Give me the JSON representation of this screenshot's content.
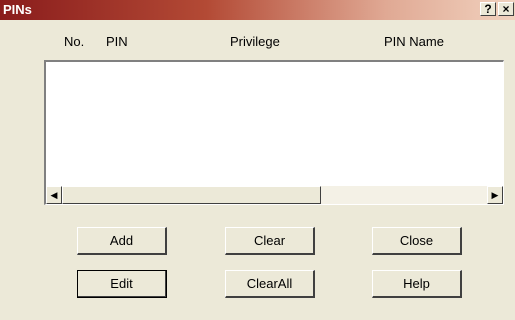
{
  "window": {
    "title": "PINs",
    "help_label": "?",
    "close_label": "×"
  },
  "columns": {
    "no": "No.",
    "pin": "PIN",
    "privilege": "Privilege",
    "pin_name": "PIN Name"
  },
  "list": {
    "rows": []
  },
  "scrollbar": {
    "left_arrow": "◀",
    "right_arrow": "▶"
  },
  "buttons": {
    "add": "Add",
    "clear": "Clear",
    "close": "Close",
    "edit": "Edit",
    "clear_all": "ClearAll",
    "help": "Help"
  },
  "colors": {
    "titlebar_start": "#8a1c1c",
    "titlebar_end": "#f1d2bf",
    "dialog_bg": "#ece9d8"
  }
}
